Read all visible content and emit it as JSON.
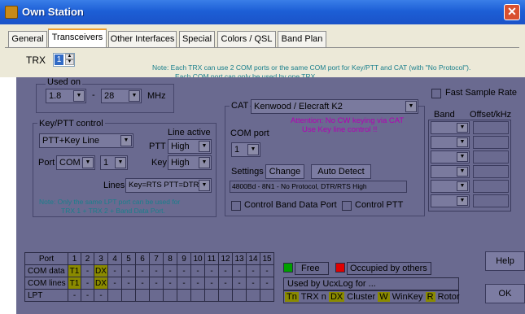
{
  "window": {
    "title": "Own Station",
    "close_glyph": "✕"
  },
  "tabs": [
    {
      "label": "General"
    },
    {
      "label": "Transceivers"
    },
    {
      "label": "Other Interfaces"
    },
    {
      "label": "Special"
    },
    {
      "label": "Colors / QSL"
    },
    {
      "label": "Band Plan"
    }
  ],
  "trx": {
    "label": "TRX",
    "value": "1"
  },
  "note": {
    "line1": "Note: Each TRX can use 2 COM ports or the same COM port for Key/PTT and CAT (with \"No Protocol\").",
    "line2": "Each COM port can only be used by one TRX."
  },
  "used_on": {
    "title": "Used on",
    "from": "1.8",
    "dash": "-",
    "to": "28",
    "unit": "MHz"
  },
  "key_ptt": {
    "title": "Key/PTT control",
    "mode": "PTT+Key Line",
    "line_active_label": "Line active",
    "ptt_label": "PTT",
    "ptt_value": "High",
    "key_label": "Key",
    "key_value": "High",
    "port_label": "Port",
    "port_value": "COM",
    "port_num": "1",
    "lines_label": "Lines",
    "lines_value": "Key=RTS PTT=DTR",
    "note1": "Note: Only the same LPT port can be used for",
    "note2": "TRX 1 + TRX 2 + Band Data Port."
  },
  "cat": {
    "title": "CAT",
    "rig": "Kenwood / Elecraft K2",
    "attention1": "Attention: No CW keying via CAT",
    "attention2": "Use Key line control !!",
    "com_port_label": "COM port",
    "com_port_value": "1",
    "settings_label": "Settings",
    "change_button": "Change",
    "auto_detect_button": "Auto Detect",
    "settings_value": "4800Bd - 8N1 - No Protocol, DTR/RTS High",
    "control_band_data_port": "Control Band Data Port",
    "control_ptt": "Control PTT"
  },
  "fast_sample_rate": "Fast Sample Rate",
  "band_table": {
    "col_band": "Band",
    "col_offset": "Offset/kHz",
    "rows": 6
  },
  "port_grid": {
    "header": [
      "Port",
      "1",
      "2",
      "3",
      "4",
      "5",
      "6",
      "7",
      "8",
      "9",
      "10",
      "11",
      "12",
      "13",
      "14",
      "15"
    ],
    "rows": [
      {
        "label": "COM data",
        "cells": [
          "T1",
          "-",
          "DX",
          "-",
          "-",
          "-",
          "-",
          "-",
          "-",
          "-",
          "-",
          "-",
          "-",
          "-",
          "-"
        ]
      },
      {
        "label": "COM lines",
        "cells": [
          "T1",
          "-",
          "DX",
          "-",
          "-",
          "-",
          "-",
          "-",
          "-",
          "-",
          "-",
          "-",
          "-",
          "-",
          "-"
        ]
      },
      {
        "label": "LPT",
        "cells": [
          "-",
          "-",
          "-",
          "",
          "",
          "",
          "",
          "",
          "",
          "",
          "",
          "",
          "",
          "",
          ""
        ]
      }
    ]
  },
  "legend": {
    "free": "Free",
    "occupied": "Occupied by others",
    "used_by": "Used by UcxLog for ...",
    "items": [
      {
        "code": "Tn",
        "text": "TRX n"
      },
      {
        "code": "DX",
        "text": "Cluster"
      },
      {
        "code": "W",
        "text": "WinKey"
      },
      {
        "code": "R",
        "text": "Rotor"
      }
    ]
  },
  "buttons": {
    "help": "Help",
    "ok": "OK"
  },
  "colors": {
    "title_bar": "#1d5fd6",
    "free_green": "#00a000",
    "occupied_red": "#e00000",
    "used_yellow": "#8a8a00"
  }
}
